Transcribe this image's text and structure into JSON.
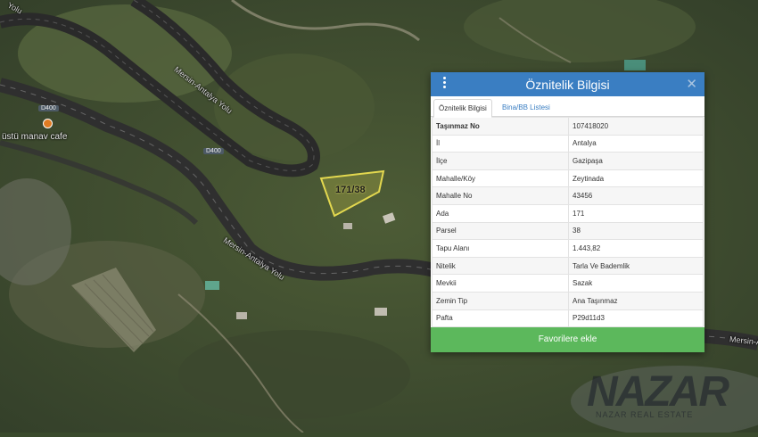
{
  "map": {
    "road_labels": [
      "Mersin-Antalya Yolu",
      "Mersin-Antalya Yolu",
      "Mersin-A",
      "Yolu"
    ],
    "road_shields": [
      "D400",
      "D400"
    ],
    "poi": {
      "label": "üstü manav cafe",
      "icon": "cafe-marker-icon"
    },
    "parcel": {
      "label": "171/38"
    }
  },
  "panel": {
    "title": "Öznitelik Bilgisi",
    "menu_icon": "kebab-menu-icon",
    "close_icon": "close-icon",
    "tabs": [
      {
        "label": "Öznitelik Bilgisi",
        "active": true
      },
      {
        "label": "Bina/BB Listesi",
        "active": false
      }
    ],
    "rows": [
      {
        "key": "Taşınmaz No",
        "value": "107418020"
      },
      {
        "key": "İl",
        "value": "Antalya"
      },
      {
        "key": "İlçe",
        "value": "Gazipaşa"
      },
      {
        "key": "Mahalle/Köy",
        "value": "Zeytinada"
      },
      {
        "key": "Mahalle No",
        "value": "43456"
      },
      {
        "key": "Ada",
        "value": "171"
      },
      {
        "key": "Parsel",
        "value": "38"
      },
      {
        "key": "Tapu Alanı",
        "value": "1.443,82"
      },
      {
        "key": "Nitelik",
        "value": "Tarla Ve Bademlik"
      },
      {
        "key": "Mevkii",
        "value": "Sazak"
      },
      {
        "key": "Zemin Tip",
        "value": "Ana Taşınmaz"
      },
      {
        "key": "Pafta",
        "value": "P29d11d3"
      }
    ],
    "favorite_button": "Favorilere ekle",
    "colors": {
      "header": "#3a7ec2",
      "button": "#5cb85c"
    }
  },
  "watermark": {
    "brand": "NAZAR",
    "tagline": "NAZAR REAL ESTATE"
  }
}
